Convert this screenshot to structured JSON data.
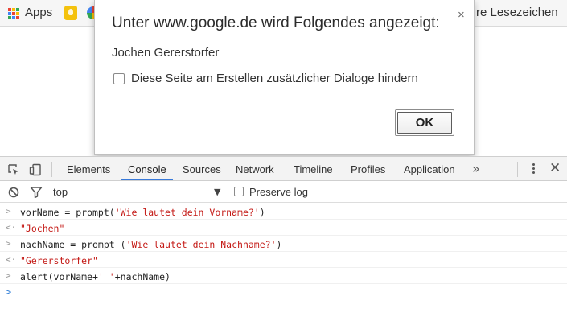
{
  "bookmarks": {
    "apps_label": "Apps",
    "other_bookmarks": "re Lesezeichen",
    "apps_colors": [
      "#ea4335",
      "#fbbc05",
      "#34a853",
      "#4285f4",
      "#ea4335",
      "#fbbc05",
      "#34a853",
      "#4285f4",
      "#ea4335"
    ]
  },
  "dialog": {
    "title": "Unter www.google.de wird Folgendes angezeigt:",
    "close": "×",
    "message": "Jochen Gererstorfer",
    "checkbox_label": "Diese Seite am Erstellen zusätzlicher Dialoge hindern",
    "ok_label": "OK"
  },
  "devtools": {
    "tabs": [
      "Elements",
      "Console",
      "Sources",
      "Network",
      "Timeline",
      "Profiles",
      "Application"
    ],
    "active_tab": "Console",
    "more": "»",
    "close": "✕",
    "accent_color": "#3879d9"
  },
  "console": {
    "context": "top",
    "context_arrow": "▼",
    "preserve_log_label": "Preserve log",
    "lines": [
      {
        "prefix": ">",
        "parts": [
          {
            "t": "vorName = prompt("
          },
          {
            "t": "'Wie lautet dein Vorname?'",
            "s": true
          },
          {
            "t": ")"
          }
        ]
      },
      {
        "prefix": "<·",
        "parts": [
          {
            "t": "\"Jochen\"",
            "s": true
          }
        ]
      },
      {
        "prefix": ">",
        "parts": [
          {
            "t": "nachName = prompt ("
          },
          {
            "t": "'Wie lautet dein Nachname?'",
            "s": true
          },
          {
            "t": ")"
          }
        ]
      },
      {
        "prefix": "<·",
        "parts": [
          {
            "t": "\"Gererstorfer\"",
            "s": true
          }
        ]
      },
      {
        "prefix": ">",
        "parts": [
          {
            "t": "alert(vorName+"
          },
          {
            "t": "' '",
            "s": true
          },
          {
            "t": "+nachName)"
          }
        ]
      }
    ],
    "prompt_symbol": ">"
  }
}
